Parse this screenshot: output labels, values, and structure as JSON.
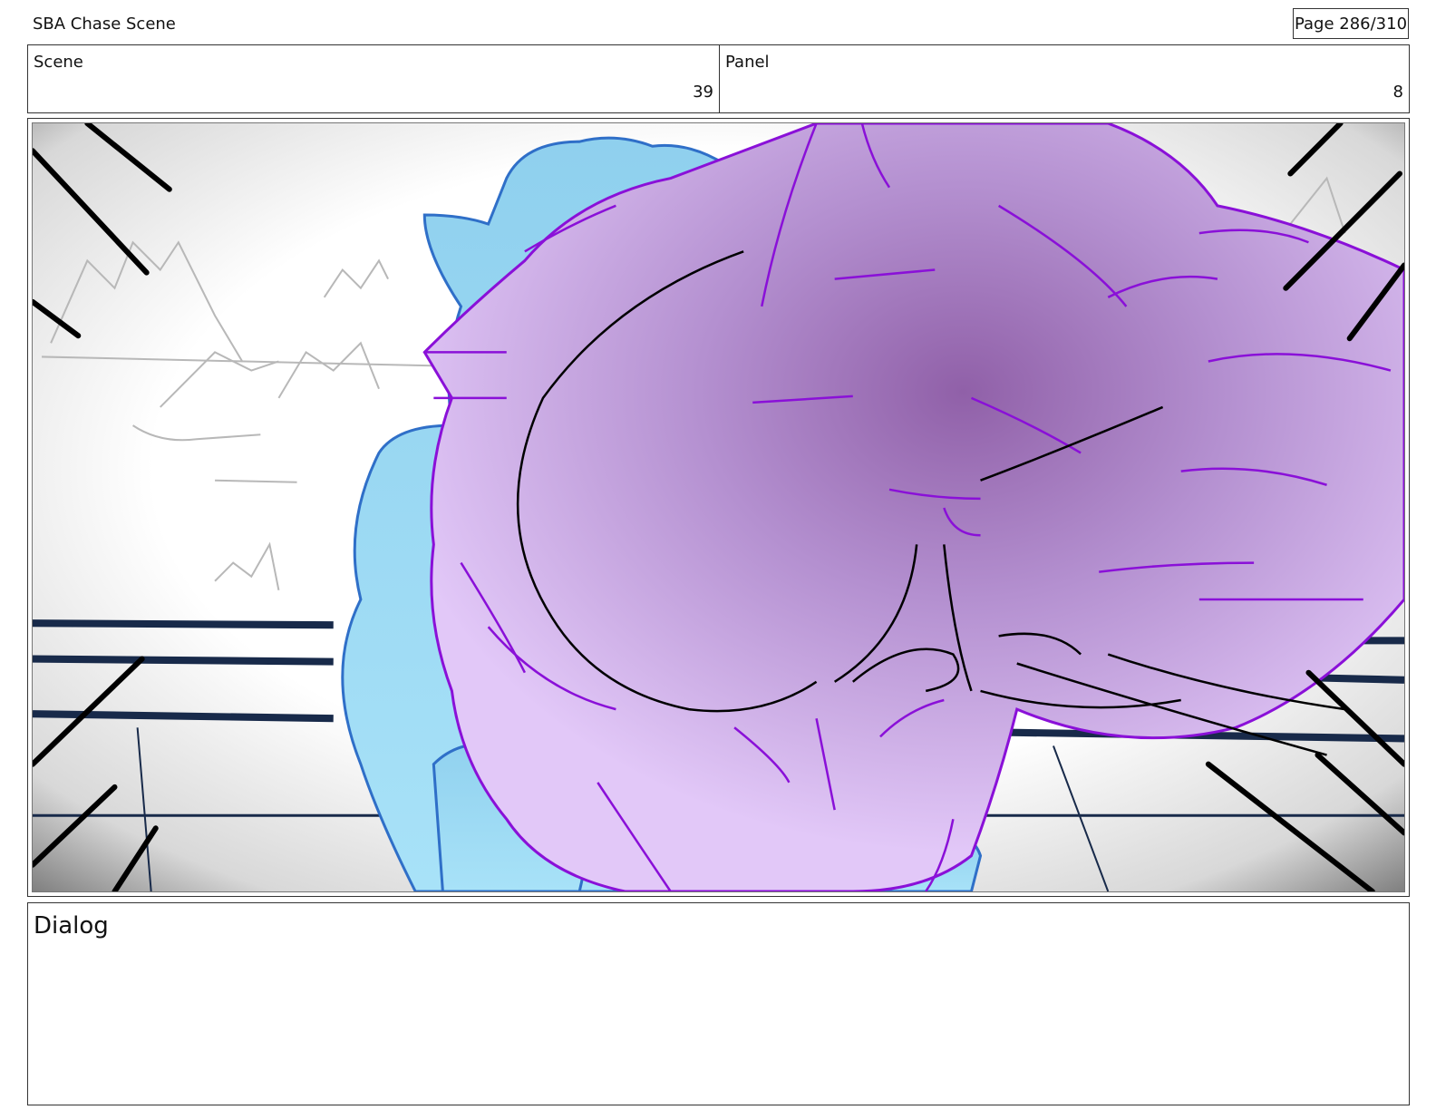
{
  "header": {
    "title": "SBA Chase Scene",
    "page": "Page 286/310"
  },
  "info": {
    "scene_label": "Scene",
    "scene_value": "39",
    "panel_label": "Panel",
    "panel_value": "8"
  },
  "dialog": {
    "label": "Dialog"
  },
  "colors": {
    "purple_fill": "#e2c8f8",
    "purple_line": "#8a10d8",
    "blue_fill": "#a8e2f8",
    "blue_line": "#2f6fc8",
    "rail_navy": "#182a4a"
  }
}
